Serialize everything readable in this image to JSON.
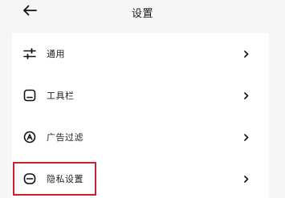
{
  "header": {
    "title": "设置",
    "back_icon": "arrow-left-icon"
  },
  "settings": {
    "items": [
      {
        "label": "通用",
        "icon": "sliders-icon"
      },
      {
        "label": "工具栏",
        "icon": "toolbar-icon"
      },
      {
        "label": "广告过滤",
        "icon": "ad-block-icon"
      },
      {
        "label": "隐私设置",
        "icon": "privacy-mask-icon",
        "highlighted": true
      }
    ],
    "chevron_icon": "chevron-right-icon"
  },
  "colors": {
    "background": "#f6f6f6",
    "row_background": "#ffffff",
    "highlight_border": "#d0202e",
    "text": "#1e1e1e"
  }
}
